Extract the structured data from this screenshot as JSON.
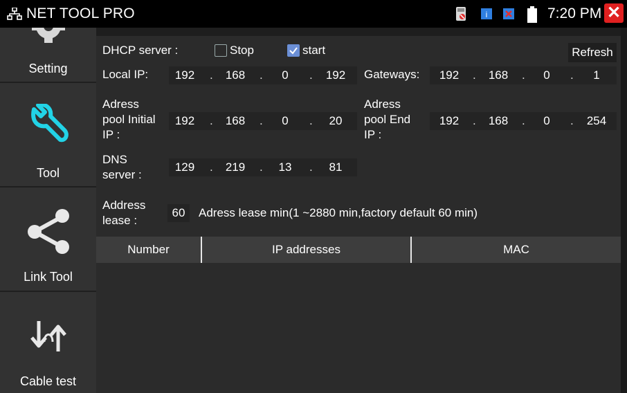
{
  "status_bar": {
    "app_title": "NET TOOL PRO",
    "clock": "7:20 PM",
    "close_label": "✕"
  },
  "sidebar": {
    "items": [
      {
        "label": "Setting",
        "icon": "gear-icon"
      },
      {
        "label": "Tool",
        "icon": "wrench-icon"
      },
      {
        "label": "Link Tool",
        "icon": "share-icon"
      },
      {
        "label": "Cable test",
        "icon": "cable-test-icon"
      }
    ]
  },
  "dhcp": {
    "server_label": "DHCP server :",
    "stop_label": "Stop",
    "stop_checked": false,
    "start_label": "start",
    "start_checked": true,
    "refresh_label": "Refresh",
    "local_ip_label": "Local IP:",
    "local_ip": [
      "192",
      "168",
      "0",
      "192"
    ],
    "gateways_label": "Gateways:",
    "gateways": [
      "192",
      "168",
      "0",
      "1"
    ],
    "pool_initial_label": [
      "Adress",
      "pool Initial",
      "IP :"
    ],
    "pool_initial": [
      "192",
      "168",
      "0",
      "20"
    ],
    "pool_end_label": [
      "Adress",
      "pool End",
      "IP :"
    ],
    "pool_end": [
      "192",
      "168",
      "0",
      "254"
    ],
    "dns_label": [
      "DNS",
      "server :"
    ],
    "dns": [
      "129",
      "219",
      "13",
      "81"
    ],
    "lease_label": [
      "Address",
      "lease :"
    ],
    "lease_value": "60",
    "lease_hint": "Adress lease min(1 ~2880 min,factory default 60 min)"
  },
  "table": {
    "columns": [
      "Number",
      "IP addresses",
      "MAC"
    ],
    "rows": []
  },
  "colors": {
    "accent_cyan": "#22d3e6",
    "close_red": "#e02020",
    "checkbox_blue": "#6b8fd6"
  }
}
